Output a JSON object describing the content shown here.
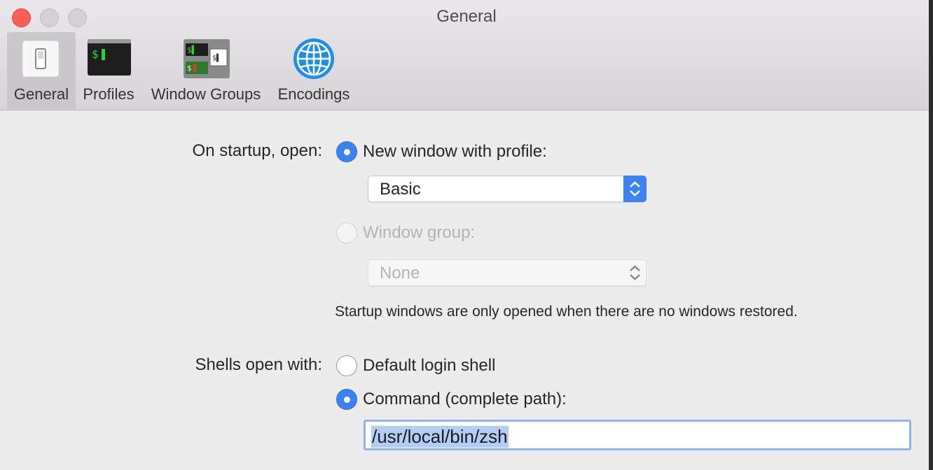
{
  "window": {
    "title": "General"
  },
  "toolbar": {
    "tabs": [
      {
        "label": "General",
        "icon": "switch-icon",
        "active": true
      },
      {
        "label": "Profiles",
        "icon": "terminal-icon"
      },
      {
        "label": "Window Groups",
        "icon": "window-groups-icon"
      },
      {
        "label": "Encodings",
        "icon": "globe-icon"
      }
    ]
  },
  "startup": {
    "label": "On startup, open:",
    "option_profile": "New window with profile:",
    "profile_value": "Basic",
    "option_group": "Window group:",
    "group_value": "None",
    "note": "Startup windows are only opened when there are no windows restored."
  },
  "shells": {
    "label": "Shells open with:",
    "option_default": "Default login shell",
    "option_command": "Command (complete path):",
    "command_value": "/usr/local/bin/zsh"
  },
  "colors": {
    "accent": "#3b82f6",
    "close": "#fc5f57"
  }
}
